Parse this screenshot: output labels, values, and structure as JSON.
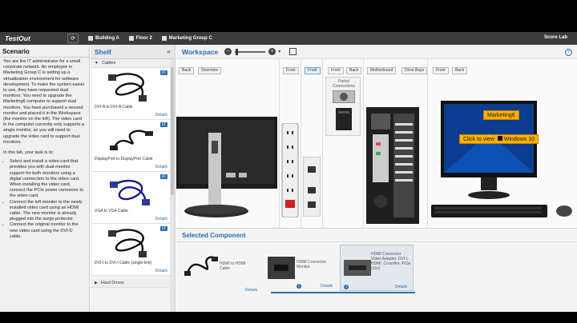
{
  "app": {
    "logo": "TestOut",
    "score_lab": "Score Lab"
  },
  "breadcrumbs": [
    {
      "label": "Building A"
    },
    {
      "label": "Floor 2"
    },
    {
      "label": "Marketing Group C"
    }
  ],
  "scenario": {
    "title": "Scenario",
    "intro": "You are the IT administrator for a small corporate network. An employee in Marketing Group C is setting up a virtualization environment for software development. To make the system easier to use, they have requested dual monitors. You need to upgrade the Marketing6 computer to support dual monitors. You have purchased a second monitor and placed it in the Workspace (the monitor on the left). The video card in the computer currently only supports a single monitor, so you will need to upgrade the video card to support dual monitors.",
    "task_intro": "In this lab, your task is to:",
    "tasks": [
      "Select and install a video card that provides you with dual-monitor support for both monitors using a digital connection to the video card. When installing the video card, connect the PCIe power connector to the video card.",
      "Connect the left monitor to the newly installed video card using an HDMI cable. The new monitor is already plugged into the surge protector.",
      "Connect the original monitor to the new video card using the DVI-D cable."
    ]
  },
  "shelf": {
    "title": "Shelf",
    "collapse_icon": "«",
    "category_cables": "Cables",
    "category_hard_drives": "Hard Drives",
    "items": [
      {
        "name": "DVI-A to DVI-A Cable",
        "qty": "x1",
        "details": "Details"
      },
      {
        "name": "DisplayPort to DisplayPort Cable",
        "qty": "x1",
        "details": "Details"
      },
      {
        "name": "VGA to VGA Cable",
        "qty": "x1",
        "details": "Details"
      },
      {
        "name": "DVI-I to DVI-I Cable (single-link)",
        "qty": "x1",
        "details": "Details"
      }
    ]
  },
  "workspace": {
    "title": "Workspace",
    "help": "?",
    "monitor_left_buttons": [
      "Back",
      "Overview"
    ],
    "surge_buttons": [
      "Front"
    ],
    "front_popup_button": "Front",
    "popup_label": "Partial Connections",
    "mb_buttons": [
      "Front",
      "Back",
      "Motherboard",
      "Drive Bays"
    ],
    "monitor_right_buttons": [
      "Front",
      "Back"
    ],
    "screen_label": "Marketing6",
    "screen_click": "Click to view",
    "screen_os": "Windows 10"
  },
  "selected": {
    "title": "Selected Component",
    "items": [
      {
        "label": "HDMI to HDMI Cable",
        "details": "Details"
      },
      {
        "label": "HDMI Connector Monitor",
        "details": "Details"
      },
      {
        "label": "HDMI Connector Video Adapter, DVI-I, HDMI, Crossfire, PCIe (16x)",
        "details": "Details"
      }
    ]
  },
  "colors": {
    "accent": "#2a6db0",
    "topbar": "#3b3b3b",
    "badge": "#2a6db0"
  }
}
